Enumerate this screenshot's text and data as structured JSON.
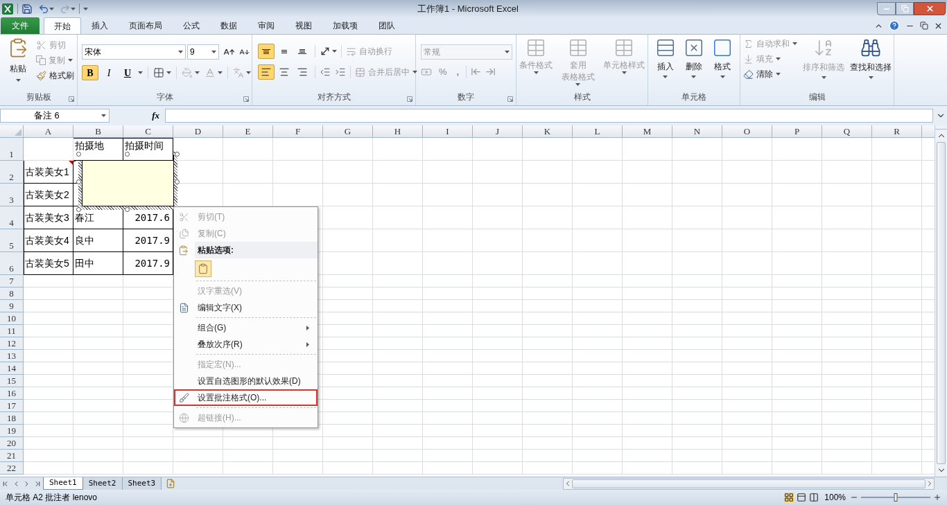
{
  "window": {
    "title": "工作簿1 - Microsoft Excel"
  },
  "ribbon_tabs": [
    {
      "label": "文件",
      "kind": "file",
      "selected": false
    },
    {
      "label": "开始",
      "kind": "tab",
      "selected": true
    },
    {
      "label": "插入",
      "kind": "tab",
      "selected": false
    },
    {
      "label": "页面布局",
      "kind": "tab",
      "selected": false
    },
    {
      "label": "公式",
      "kind": "tab",
      "selected": false
    },
    {
      "label": "数据",
      "kind": "tab",
      "selected": false
    },
    {
      "label": "审阅",
      "kind": "tab",
      "selected": false
    },
    {
      "label": "视图",
      "kind": "tab",
      "selected": false
    },
    {
      "label": "加载项",
      "kind": "tab",
      "selected": false
    },
    {
      "label": "团队",
      "kind": "tab",
      "selected": false
    }
  ],
  "clipboard": {
    "title": "剪贴板",
    "paste": "粘贴",
    "cut": {
      "label": "剪切",
      "disabled": true
    },
    "copy": {
      "label": "复制",
      "disabled": true
    },
    "format_painter": {
      "label": "格式刷",
      "disabled": false
    }
  },
  "font": {
    "title": "字体",
    "name": "宋体",
    "size": "9",
    "styles": [
      {
        "label": "B",
        "selected": true
      },
      {
        "label": "I",
        "selected": false
      },
      {
        "label": "U",
        "selected": false
      }
    ]
  },
  "alignment": {
    "title": "对齐方式",
    "vertical": [
      {
        "kind": "top",
        "selected": true
      },
      {
        "kind": "middle",
        "selected": false
      },
      {
        "kind": "bottom",
        "selected": false
      }
    ],
    "horizontal": [
      {
        "kind": "left",
        "selected": true
      },
      {
        "kind": "center",
        "selected": false
      },
      {
        "kind": "right",
        "selected": false
      }
    ],
    "wrap_text": {
      "label": "自动换行",
      "disabled": true
    },
    "merge": {
      "label": "合并后居中",
      "disabled": true
    }
  },
  "number": {
    "title": "数字",
    "format": "常规",
    "disabled": true,
    "percent": "%",
    "comma": ","
  },
  "styles": {
    "title": "样式",
    "items": [
      {
        "lines": [
          "条件格式"
        ],
        "disabled": true
      },
      {
        "lines": [
          "套用",
          "表格格式"
        ],
        "disabled": true
      },
      {
        "lines": [
          "单元格样式"
        ],
        "disabled": true
      }
    ]
  },
  "cells": {
    "title": "单元格",
    "items": [
      {
        "label": "插入",
        "kind": "insert"
      },
      {
        "label": "删除",
        "kind": "delete"
      },
      {
        "label": "格式",
        "kind": "format"
      }
    ]
  },
  "editing": {
    "title": "编辑",
    "autosum": {
      "label": "自动求和",
      "disabled": true
    },
    "fill": {
      "label": "填充",
      "disabled": true
    },
    "clear": {
      "label": "清除",
      "disabled": false
    },
    "sort": {
      "label": "排序和筛选",
      "disabled": true
    },
    "find": {
      "label": "查找和选择",
      "disabled": false
    }
  },
  "formula_bar": {
    "name_box": "备注 6",
    "fx": "fx"
  },
  "sheet": {
    "columns": [
      "A",
      "B",
      "C",
      "D",
      "E",
      "F",
      "G",
      "H",
      "I",
      "J",
      "K",
      "L",
      "M",
      "N",
      "O",
      "P",
      "Q",
      "R"
    ],
    "rows": [
      {
        "label": "1",
        "cells": [
          null,
          {
            "text": "拍摄地"
          },
          {
            "text": "拍摄时间"
          }
        ]
      },
      {
        "label": "2",
        "cells": [
          {
            "text": "古装美女1",
            "has_comment": true
          },
          null,
          null
        ]
      },
      {
        "label": "3",
        "cells": [
          {
            "text": "古装美女2",
            "has_comment": false
          },
          null,
          null
        ]
      },
      {
        "label": "4",
        "cells": [
          {
            "text": "古装美女3",
            "has_comment": false
          },
          {
            "text": "春江"
          },
          {
            "text": "2017.6",
            "kind": "number"
          }
        ]
      },
      {
        "label": "5",
        "cells": [
          {
            "text": "古装美女4",
            "has_comment": false
          },
          {
            "text": "良中"
          },
          {
            "text": "2017.9",
            "kind": "number"
          }
        ]
      },
      {
        "label": "6",
        "cells": [
          {
            "text": "古装美女5",
            "has_comment": false
          },
          {
            "text": "田中"
          },
          {
            "text": "2017.9",
            "kind": "number"
          }
        ]
      },
      {
        "label": "7"
      },
      {
        "label": "8"
      },
      {
        "label": "9"
      },
      {
        "label": "10"
      },
      {
        "label": "11"
      },
      {
        "label": "12"
      },
      {
        "label": "13"
      },
      {
        "label": "14"
      },
      {
        "label": "15"
      },
      {
        "label": "16"
      },
      {
        "label": "17"
      },
      {
        "label": "18"
      },
      {
        "label": "19"
      },
      {
        "label": "20"
      },
      {
        "label": "21"
      },
      {
        "label": "22"
      }
    ]
  },
  "comment": {
    "selected": true
  },
  "context_menu": [
    {
      "kind": "cut",
      "label": "剪切(T)",
      "disabled": true,
      "outlined": false
    },
    {
      "kind": "copy",
      "label": "复制(C)",
      "disabled": true,
      "outlined": false
    },
    {
      "kind": "heading",
      "label": "粘贴选项:"
    },
    {
      "kind": "paste_option"
    },
    {
      "kind": "separator"
    },
    {
      "kind": "item",
      "label": "汉字重选(V)",
      "disabled": true,
      "outlined": false
    },
    {
      "kind": "edit_text",
      "label": "编辑文字(X)",
      "disabled": false,
      "outlined": false
    },
    {
      "kind": "separator"
    },
    {
      "kind": "submenu",
      "label": "组合(G)",
      "disabled": false,
      "outlined": false
    },
    {
      "kind": "submenu",
      "label": "叠放次序(R)",
      "disabled": false,
      "outlined": false
    },
    {
      "kind": "separator"
    },
    {
      "kind": "item",
      "label": "指定宏(N)...",
      "disabled": true,
      "outlined": false
    },
    {
      "kind": "item",
      "label": "设置自选图形的默认效果(D)",
      "disabled": false,
      "outlined": false
    },
    {
      "kind": "format_comment",
      "label": "设置批注格式(O)...",
      "disabled": false,
      "outlined": true
    },
    {
      "kind": "separator"
    },
    {
      "kind": "hyperlink",
      "label": "超链接(H)...",
      "disabled": true,
      "outlined": false
    }
  ],
  "sheet_tabs": [
    {
      "label": "Sheet1",
      "selected": true
    },
    {
      "label": "Sheet2",
      "selected": false
    },
    {
      "label": "Sheet3",
      "selected": false
    }
  ],
  "status_bar": {
    "text": "单元格 A2 批注者 lenovo",
    "zoom": {
      "label": "100%",
      "level": 0.5
    }
  }
}
